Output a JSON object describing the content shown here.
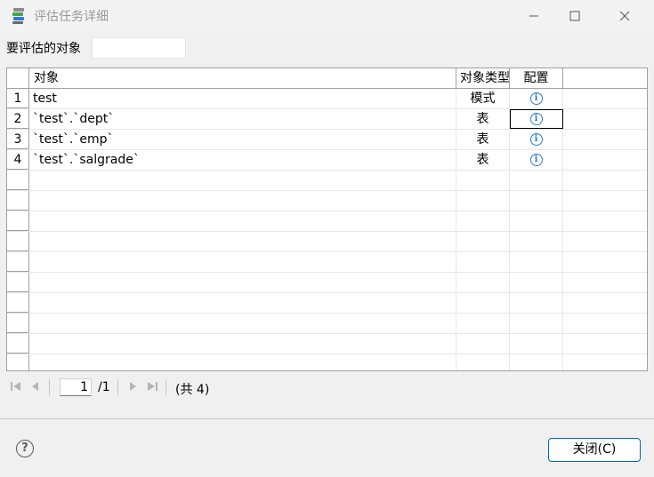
{
  "window": {
    "title": "评估任务详细",
    "icon": "database-stack-icon"
  },
  "filter": {
    "label": "要评估的对象",
    "value": ""
  },
  "table": {
    "columns": [
      "对象",
      "对象类型",
      "配置"
    ],
    "rows": [
      {
        "num": "1",
        "object": "test",
        "type": "模式",
        "config": "ⓘ"
      },
      {
        "num": "2",
        "object": "`test`.`dept`",
        "type": "表",
        "config": "ⓘ"
      },
      {
        "num": "3",
        "object": "`test`.`emp`",
        "type": "表",
        "config": "ⓘ"
      },
      {
        "num": "4",
        "object": "`test`.`salgrade`",
        "type": "表",
        "config": "ⓘ"
      }
    ]
  },
  "pager": {
    "current": "1",
    "total": "/1",
    "count": "(共 4)"
  },
  "footer": {
    "help": "?",
    "close_label": "关闭(C)"
  },
  "colors": {
    "accent": "#0067c0",
    "info": "#2a7bd6"
  }
}
